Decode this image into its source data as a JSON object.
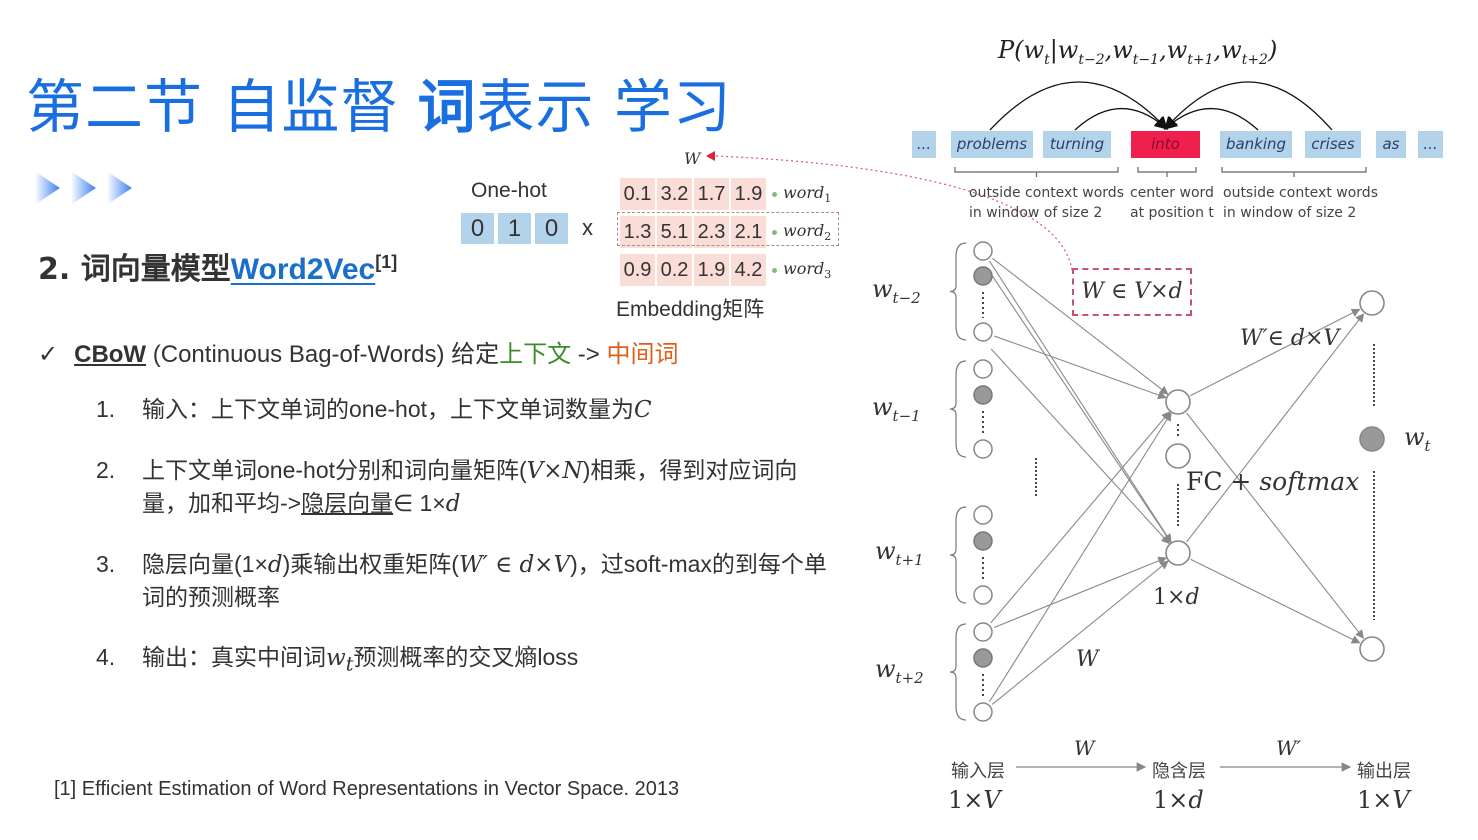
{
  "slide": {
    "title": {
      "part1": "第二节 自监督",
      "part2_bold": "词",
      "part3": "表示 学习"
    },
    "heading": {
      "prefix": "2. 词向量模型",
      "link": "Word2Vec",
      "ref": "[1]"
    },
    "cbow": {
      "check": "✓",
      "name": "CBoW",
      "full": " (Continuous Bag-of-Words) 给定",
      "context": "上下文",
      "arrow": " -> ",
      "center": "中间词"
    },
    "steps": [
      {
        "num": "1.",
        "text_a": "输入：上下文单词的one-hot，上下文单词数量为",
        "math_a": "C"
      },
      {
        "num": "2.",
        "text_a": "上下文单词one-hot分别和词向量矩阵(",
        "math_a": "V×N",
        "text_b": ")相乘，得到对应词向量，加和平均->",
        "underlined": "隐层向量",
        "text_c": "∈ 1×",
        "math_b": "d"
      },
      {
        "num": "3.",
        "text_a": "隐层向量(1×",
        "math_a": "d",
        "text_b": ")乘输出权重矩阵(",
        "math_b": "W′ ∈ d×V",
        "text_c": ")，过soft-max的到每个单词的预测概率"
      },
      {
        "num": "4.",
        "text_a": "输出：真实中间词",
        "math_a": "w",
        "sub_a": "t",
        "text_b": "预测概率的交叉熵loss"
      }
    ],
    "footnote": "[1] Efficient Estimation of Word Representations in Vector Space. 2013"
  },
  "embedding": {
    "onehot_label": "One-hot",
    "onehot": [
      "0",
      "1",
      "0"
    ],
    "times": "x",
    "w_label": "W",
    "matrix": [
      {
        "values": [
          "0.1",
          "3.2",
          "1.7",
          "1.9"
        ],
        "word": "word",
        "idx": "1"
      },
      {
        "values": [
          "1.3",
          "5.1",
          "2.3",
          "2.1"
        ],
        "word": "word",
        "idx": "2"
      },
      {
        "values": [
          "0.9",
          "0.2",
          "1.9",
          "4.2"
        ],
        "word": "word",
        "idx": "3"
      }
    ],
    "label": "Embedding矩阵"
  },
  "sequence": {
    "probability": "P(w_t | w_t−2, w_t−1, w_t+1, w_t+2)",
    "prob_parts": {
      "P": "P(",
      "wt": "w",
      "t": "t",
      "bar": "|",
      "w1": "w",
      "s1": "t−2",
      "w2": "w",
      "s2": "t−1",
      "w3": "w",
      "s3": "t+1",
      "w4": "w",
      "s4": "t+2",
      "close": ")"
    },
    "tokens": [
      "...",
      "problems",
      "turning",
      "into",
      "banking",
      "crises",
      "as",
      "..."
    ],
    "center_index": 3,
    "labels": {
      "left": [
        "outside context words",
        "in window of size 2"
      ],
      "center": [
        "center word",
        "at position t"
      ],
      "right": [
        "outside context words",
        "in window of size 2"
      ]
    }
  },
  "network": {
    "inputs": [
      {
        "w": "w",
        "sub": "t−2"
      },
      {
        "w": "w",
        "sub": "t−1"
      },
      {
        "w": "w",
        "sub": "t+1"
      },
      {
        "w": "w",
        "sub": "t+2"
      }
    ],
    "w_box": "W ∈ V×d",
    "w_prime": "W′∈ d×V",
    "fc_label": "FC + ",
    "softmax": "softmax",
    "hidden_dim": "1×",
    "hidden_dim_d": "d",
    "w_edge": "W",
    "output_w": "w",
    "output_sub": "t"
  },
  "pipeline": {
    "input_layer": "输入层",
    "hidden_layer": "隐含层",
    "output_layer": "输出层",
    "w": "W",
    "w_prime": "W′",
    "input_dim_a": "1×",
    "input_dim_b": "V",
    "hidden_dim_a": "1×",
    "hidden_dim_b": "d",
    "output_dim_a": "1×",
    "output_dim_b": "V"
  },
  "colors": {
    "title": "#1a6fe0",
    "link": "#1a6fc9",
    "context_green": "#3d8c2c",
    "center_orange": "#e0601a",
    "token_bg": "#b3d3ea",
    "center_token": "#f0204e",
    "matrix_bg": "#f9ddd6"
  }
}
